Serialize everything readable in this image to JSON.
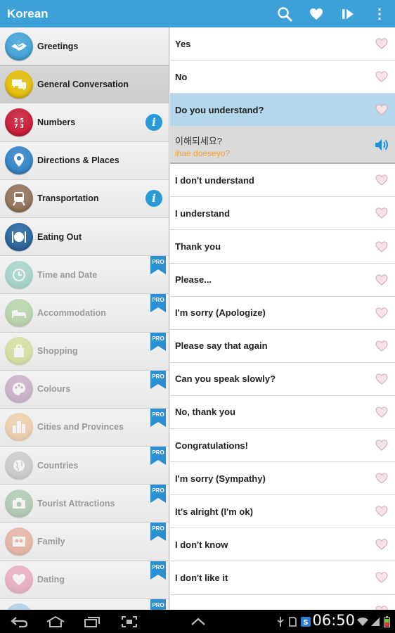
{
  "app": {
    "title": "Korean"
  },
  "categories": [
    {
      "label": "Greetings",
      "icon": "handshake-icon",
      "color": "#3a9fd6",
      "locked": false,
      "info": false,
      "selected": false
    },
    {
      "label": "General Conversation",
      "icon": "speech-bubbles-icon",
      "color": "#e5c000",
      "locked": false,
      "info": false,
      "selected": true
    },
    {
      "label": "Numbers",
      "icon": "numbers-icon",
      "color": "#c8102e",
      "locked": false,
      "info": true,
      "selected": false
    },
    {
      "label": "Directions & Places",
      "icon": "map-pin-icon",
      "color": "#2a7fc4",
      "locked": false,
      "info": false,
      "selected": false
    },
    {
      "label": "Transportation",
      "icon": "train-icon",
      "color": "#8d6e52",
      "locked": false,
      "info": true,
      "selected": false
    },
    {
      "label": "Eating Out",
      "icon": "plate-cutlery-icon",
      "color": "#1e5d99",
      "locked": false,
      "info": false,
      "selected": false
    },
    {
      "label": "Time and Date",
      "icon": "clock-icon",
      "color": "#2aa58a",
      "locked": true,
      "info": false,
      "selected": false
    },
    {
      "label": "Accommodation",
      "icon": "bed-icon",
      "color": "#5aa63a",
      "locked": true,
      "info": false,
      "selected": false
    },
    {
      "label": "Shopping",
      "icon": "shopping-bag-icon",
      "color": "#a8c21a",
      "locked": true,
      "info": false,
      "selected": false
    },
    {
      "label": "Colours",
      "icon": "palette-icon",
      "color": "#8a4a8a",
      "locked": true,
      "info": false,
      "selected": false
    },
    {
      "label": "Cities and Provinces",
      "icon": "city-icon",
      "color": "#e79a3a",
      "locked": true,
      "info": false,
      "selected": false
    },
    {
      "label": "Countries",
      "icon": "globe-icon",
      "color": "#8e8e8e",
      "locked": true,
      "info": false,
      "selected": false
    },
    {
      "label": "Tourist Attractions",
      "icon": "camera-icon",
      "color": "#4c8a57",
      "locked": true,
      "info": false,
      "selected": false
    },
    {
      "label": "Family",
      "icon": "family-photo-icon",
      "color": "#d9532b",
      "locked": true,
      "info": false,
      "selected": false
    },
    {
      "label": "Dating",
      "icon": "heart-icon",
      "color": "#e0407c",
      "locked": true,
      "info": false,
      "selected": false
    },
    {
      "label": "",
      "icon": "category-icon",
      "color": "#3a9fd6",
      "locked": true,
      "info": false,
      "selected": false
    }
  ],
  "badges": {
    "pro": "PRO",
    "info": "i"
  },
  "phrases_before": [
    {
      "text": "Yes"
    },
    {
      "text": "No"
    }
  ],
  "selected_phrase": {
    "text": "Do you understand?",
    "korean": "이해되세요?",
    "romanization": "ihae doeseyo?"
  },
  "phrases_after": [
    {
      "text": "I don't understand"
    },
    {
      "text": "I understand"
    },
    {
      "text": "Thank you"
    },
    {
      "text": "Please..."
    },
    {
      "text": "I'm sorry (Apologize)"
    },
    {
      "text": "Please say that again"
    },
    {
      "text": "Can you speak slowly?"
    },
    {
      "text": "No, thank you"
    },
    {
      "text": "Congratulations!"
    },
    {
      "text": "I'm sorry (Sympathy)"
    },
    {
      "text": "It's alright (I'm ok)"
    },
    {
      "text": "I don't know"
    },
    {
      "text": "I don't like it"
    },
    {
      "text": ""
    }
  ],
  "status": {
    "time": "06:50"
  },
  "colors": {
    "actionbar": "#3ea0d9",
    "selected_row": "#b5d7ec",
    "romanization": "#f3a02b",
    "pro_ribbon": "#2a8fd3"
  }
}
